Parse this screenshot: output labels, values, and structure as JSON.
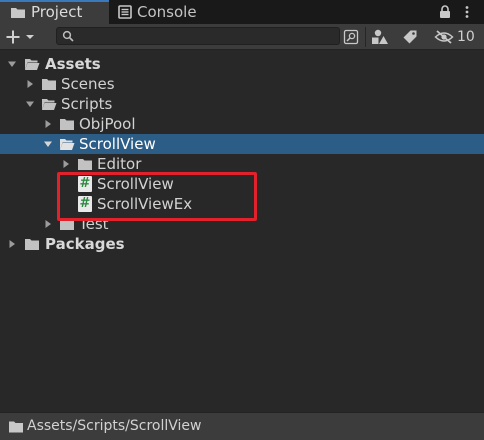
{
  "tabs": [
    {
      "label": "Project",
      "icon": "folder-icon",
      "active": true
    },
    {
      "label": "Console",
      "icon": "console-icon",
      "active": false
    }
  ],
  "toolbar": {
    "search_value": "",
    "hidden_count": "10"
  },
  "tree": [
    {
      "label": "Assets",
      "type": "folder",
      "expanded": true,
      "bold": true
    },
    {
      "label": "Scenes",
      "type": "folder",
      "expanded": false
    },
    {
      "label": "Scripts",
      "type": "folder",
      "expanded": true
    },
    {
      "label": "ObjPool",
      "type": "folder",
      "expanded": false
    },
    {
      "label": "ScrollView",
      "type": "folder",
      "expanded": true,
      "selected": true
    },
    {
      "label": "Editor",
      "type": "folder",
      "expanded": false
    },
    {
      "label": "ScrollView",
      "type": "csharp-script"
    },
    {
      "label": "ScrollViewEx",
      "type": "csharp-script"
    },
    {
      "label": "Test",
      "type": "folder",
      "expanded": false
    },
    {
      "label": "Packages",
      "type": "folder",
      "expanded": false,
      "bold": true
    }
  ],
  "script_icon_glyph": "#",
  "status": {
    "path": "Assets/Scripts/ScrollView"
  },
  "colors": {
    "selection": "#2c5d87",
    "highlight_box": "#e1212c",
    "tab_accent": "#3a79bb"
  }
}
